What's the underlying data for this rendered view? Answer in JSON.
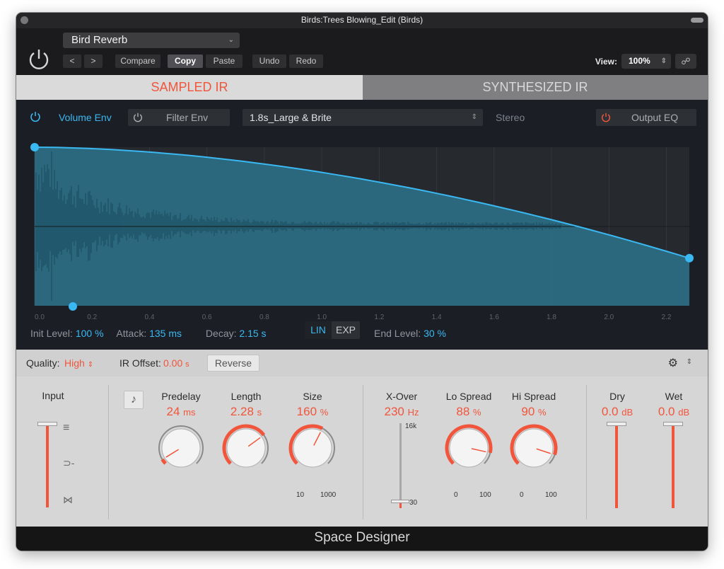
{
  "title": "Birds:Trees Blowing_Edit (Birds)",
  "header": {
    "preset": "Bird Reverb",
    "buttons": {
      "prev": "<",
      "next": ">",
      "compare": "Compare",
      "copy": "Copy",
      "paste": "Paste",
      "undo": "Undo",
      "redo": "Redo"
    },
    "view_label": "View:",
    "view_value": "100%"
  },
  "tabs": {
    "sampled": "SAMPLED IR",
    "synthesized": "SYNTHESIZED IR"
  },
  "editor": {
    "volume_env": "Volume Env",
    "filter_env": "Filter Env",
    "ir_name": "1.8s_Large & Brite",
    "stereo": "Stereo",
    "output_eq": "Output EQ",
    "time_ticks": [
      "0.0",
      "0.2",
      "0.4",
      "0.6",
      "0.8",
      "1.0",
      "1.2",
      "1.4",
      "1.6",
      "1.8",
      "2.0",
      "2.2"
    ],
    "time_max": 2.28,
    "init_level": {
      "label": "Init Level:",
      "value": "100 %"
    },
    "attack": {
      "label": "Attack:",
      "value": "135 ms"
    },
    "decay": {
      "label": "Decay:",
      "value": "2.15 s"
    },
    "lin": "LIN",
    "exp": "EXP",
    "end_level": {
      "label": "End Level:",
      "value": "30 %"
    },
    "envelope": {
      "init": 1.0,
      "end": 0.3
    }
  },
  "controls": {
    "quality_label": "Quality:",
    "quality_value": "High",
    "ir_offset_label": "IR Offset:",
    "ir_offset_value": "0.00",
    "ir_offset_unit": "s",
    "reverse": "Reverse",
    "input": "Input",
    "predelay": {
      "label": "Predelay",
      "value": "24",
      "unit": "ms",
      "level": 0.05
    },
    "length": {
      "label": "Length",
      "value": "2.28",
      "unit": "s",
      "level": 0.7
    },
    "size": {
      "label": "Size",
      "value": "160",
      "unit": "%",
      "level": 0.6,
      "min": "10",
      "max": "1000"
    },
    "xover": {
      "label": "X-Over",
      "value": "230",
      "unit": "Hz",
      "top": "16k",
      "bottom": "30"
    },
    "lo_spread": {
      "label": "Lo Spread",
      "value": "88",
      "unit": "%",
      "level": 0.88,
      "min": "0",
      "max": "100"
    },
    "hi_spread": {
      "label": "Hi Spread",
      "value": "90",
      "unit": "%",
      "level": 0.9,
      "min": "0",
      "max": "100"
    },
    "dry": {
      "label": "Dry",
      "value": "0.0",
      "unit": "dB"
    },
    "wet": {
      "label": "Wet",
      "value": "0.0",
      "unit": "dB"
    }
  },
  "footer": "Space Designer",
  "colors": {
    "accent_red": "#f1553b",
    "accent_blue": "#3ab8f2",
    "waveform": "#2b6e86"
  }
}
